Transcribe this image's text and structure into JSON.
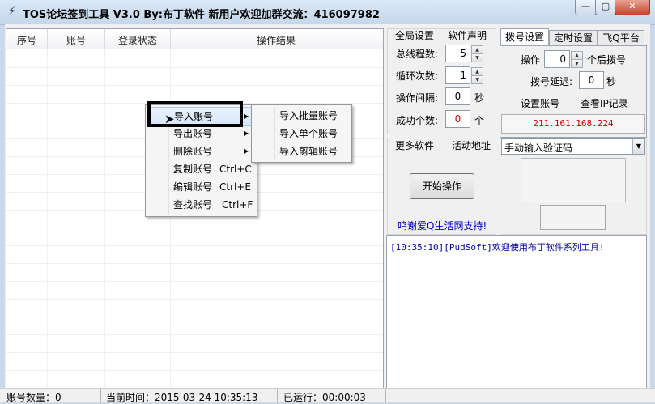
{
  "window": {
    "title": "TOS论坛签到工具 V3.0 By:布丁软件   新用户欢迎加群交流：416097982",
    "minimize_glyph": "—",
    "maximize_glyph": "▢",
    "close_glyph": "✕"
  },
  "list": {
    "columns": [
      "序号",
      "账号",
      "登录状态",
      "操作结果"
    ]
  },
  "global_settings": {
    "header_left": "全局设置",
    "header_right": "软件声明",
    "threads_label": "总线程数:",
    "threads_value": "5",
    "loops_label": "循环次数:",
    "loops_value": "1",
    "interval_label": "操作间隔:",
    "interval_value": "0",
    "interval_unit": "秒",
    "success_label": "成功个数:",
    "success_value": "0",
    "success_unit": "个",
    "more_software": "更多软件",
    "activity_url": "活动地址",
    "start_button": "开始操作",
    "thanks_link": "鸣谢爱Q生活网支持!"
  },
  "tabs": [
    "拨号设置",
    "定时设置",
    "飞Q平台"
  ],
  "dial_settings": {
    "after_label_prefix": "操作",
    "after_value": "0",
    "after_label_suffix": "个后拨号",
    "delay_label": "拨号延迟:",
    "delay_value": "0",
    "delay_unit": "秒",
    "set_account": "设置账号",
    "view_ip": "查看IP记录",
    "ip": "211.161.168.224"
  },
  "captcha": {
    "mode": "手动输入验证码"
  },
  "log": {
    "lines": [
      "[10:35:10][PudSoft]欢迎使用布丁软件系列工具!"
    ]
  },
  "status": {
    "count": "账号数量：0",
    "time": "当前时间：2015-03-24 10:35:13",
    "running": "已运行：00:00:03"
  },
  "context_menu": {
    "items": [
      {
        "label": "导入账号",
        "submenu": true
      },
      {
        "label": "导出账号",
        "submenu": true
      },
      {
        "label": "删除账号",
        "submenu": true
      },
      {
        "label": "复制账号",
        "shortcut": "Ctrl+C"
      },
      {
        "label": "编辑账号",
        "shortcut": "Ctrl+E"
      },
      {
        "label": "查找账号",
        "shortcut": "Ctrl+F"
      }
    ],
    "submenu": [
      "导入批量账号",
      "导入单个账号",
      "导入剪辑账号"
    ]
  },
  "colors": {
    "ip": "#cc0000",
    "success_value": "#cc0000",
    "thanks_link": "#0000cc",
    "log_text": "#0000aa"
  }
}
